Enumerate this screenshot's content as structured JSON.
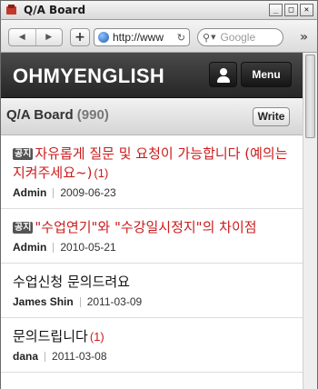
{
  "window": {
    "title": "Q/A Board"
  },
  "toolbar": {
    "back_icon": "back-arrow-icon",
    "forward_icon": "forward-arrow-icon",
    "add_tab": "+",
    "url": "http://www",
    "search_placeholder": "Google",
    "overflow": "»"
  },
  "site": {
    "logo": "OHMYENGLISH",
    "menu_label": "Menu",
    "user_icon": "user-icon"
  },
  "board": {
    "title": "Q/A Board",
    "count": "(990)",
    "write_label": "Write"
  },
  "posts": [
    {
      "notice": "공지",
      "title": "자유롭게 질문 및 요청이 가능합니다 (예의는 지켜주세요~)",
      "comments": "(1)",
      "author": "Admin",
      "date": "2009-06-23"
    },
    {
      "notice": "공지",
      "title": "\"수업연기\"와 \"수강일시정지\"의 차이점",
      "comments": "",
      "author": "Admin",
      "date": "2010-05-21"
    },
    {
      "notice": "",
      "title": "수업신청 문의드려요",
      "comments": "",
      "author": "James Shin",
      "date": "2011-03-09"
    },
    {
      "notice": "",
      "title": "문의드립니다",
      "comments": "(1)",
      "author": "dana",
      "date": "2011-03-08"
    }
  ],
  "colors": {
    "notice_title": "#cc1b1b",
    "header_bg": "#2e2e2e"
  }
}
